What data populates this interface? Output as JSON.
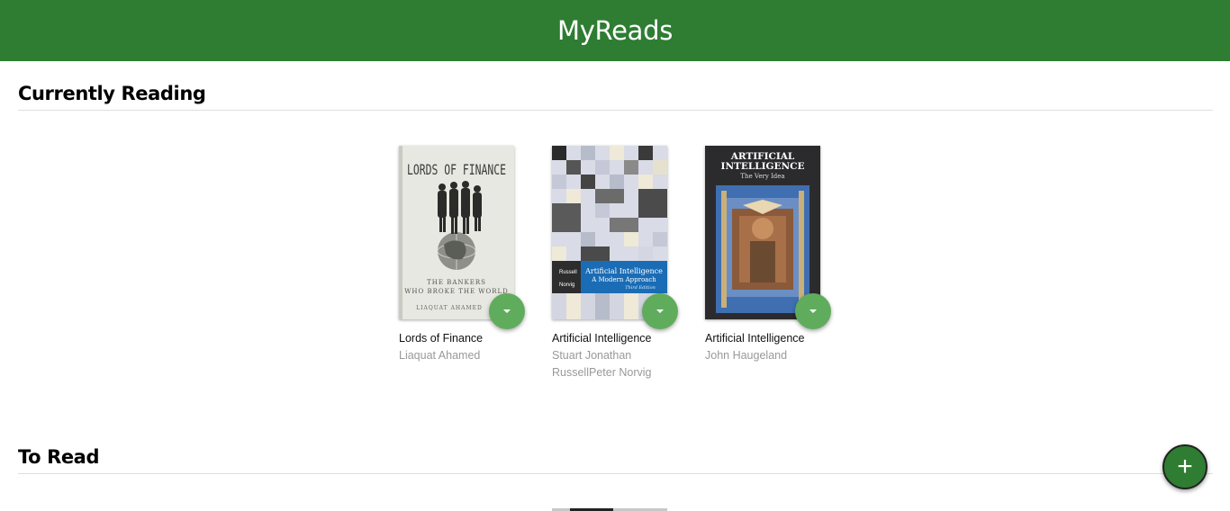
{
  "app": {
    "title": "MyReads"
  },
  "shelves": [
    {
      "title": "Currently Reading",
      "books": [
        {
          "title": "Lords of Finance",
          "authors": "Liaquat Ahamed",
          "cover_text": {
            "title": "LORDS OF FINANCE",
            "subtitle_1": "THE BANKERS",
            "subtitle_2": "WHO BROKE THE WORLD",
            "author": "LIAQUAT AHAMED"
          }
        },
        {
          "title": "Artificial Intelligence",
          "authors": "Stuart Jonathan RussellPeter Norvig",
          "cover_text": {
            "author_1": "Russell",
            "author_2": "Norvig",
            "title": "Artificial Intelligence",
            "subtitle": "A Modern Approach",
            "edition": "Third Edition"
          }
        },
        {
          "title": "Artificial Intelligence",
          "authors": "John Haugeland",
          "cover_text": {
            "title_1": "ARTIFICIAL",
            "title_2": "INTELLIGENCE",
            "subtitle": "The Very Idea"
          }
        }
      ]
    },
    {
      "title": "To Read",
      "books": []
    }
  ],
  "actions": {
    "open_search_icon": "plus-icon"
  },
  "colors": {
    "header": "#2e7d32",
    "shelf_changer": "#60ac5d",
    "search_button": "#2e7d32"
  }
}
